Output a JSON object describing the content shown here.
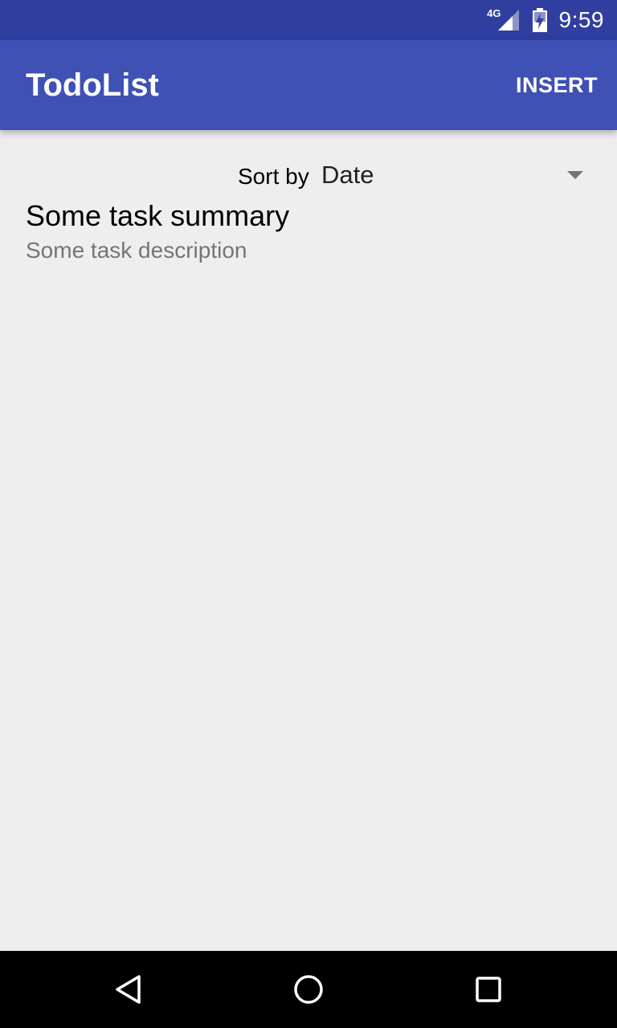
{
  "status_bar": {
    "network": "4G",
    "time": "9:59",
    "icons": [
      "signal-icon",
      "battery-icon"
    ]
  },
  "app_bar": {
    "title": "TodoList",
    "insert_label": "INSERT",
    "color": "#3f51b5",
    "status_color": "#303f9f"
  },
  "sort": {
    "label": "Sort by",
    "selected": "Date"
  },
  "tasks": [
    {
      "summary": "Some task summary",
      "description": "Some task description"
    }
  ],
  "nav_bar": {
    "icons": [
      "back-icon",
      "home-icon",
      "recents-icon"
    ]
  }
}
